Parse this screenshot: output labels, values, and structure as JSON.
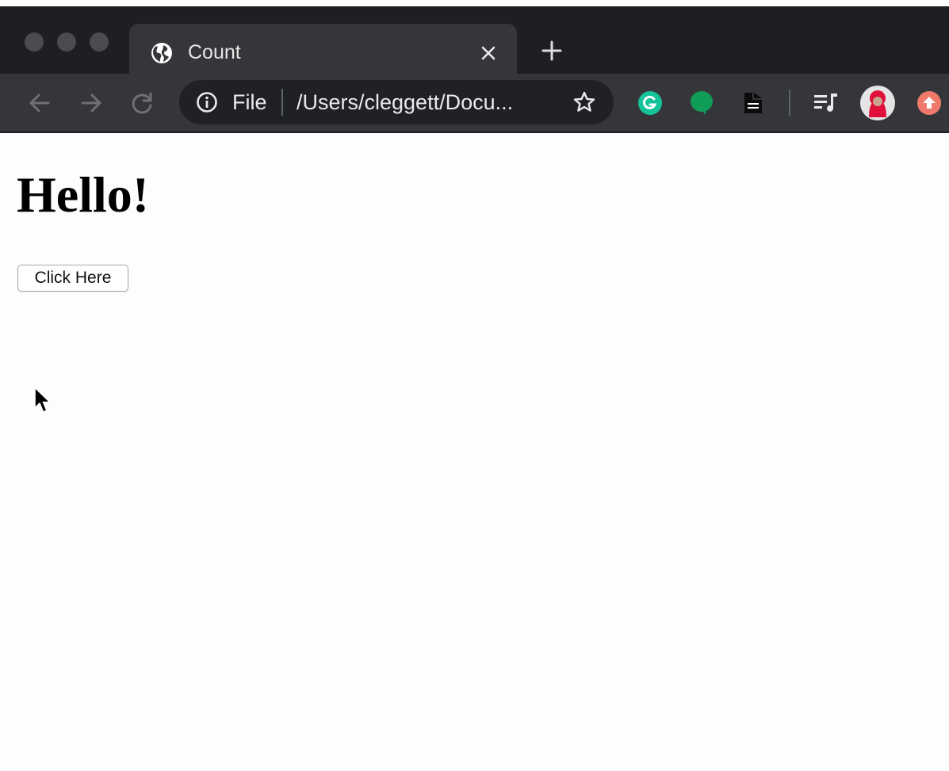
{
  "tab": {
    "title": "Count"
  },
  "omnibox": {
    "scheme": "File",
    "url": "/Users/cleggett/Docu..."
  },
  "page": {
    "heading": "Hello!",
    "button_label": "Click Here"
  },
  "extensions": [
    "grammarly-icon",
    "chat-bubble-icon",
    "document-icon",
    "media-queue-icon",
    "profile-avatar",
    "upload-icon"
  ],
  "colors": {
    "tabbar": "#1e1f23",
    "toolbar": "#35363a",
    "omnibox": "#202124",
    "grammarly": "#15c39a",
    "chat": "#0f9d58",
    "upload": "#ef7a6b",
    "page_bg": "#fdfcfe"
  }
}
